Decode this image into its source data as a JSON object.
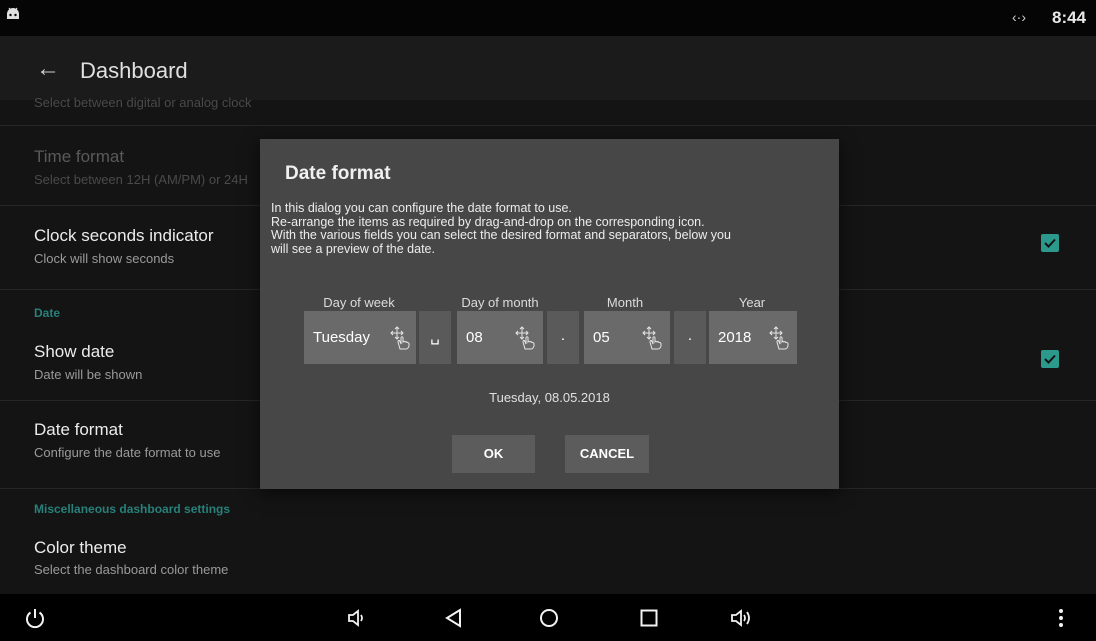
{
  "status_bar": {
    "time": "8:44",
    "signal_icon": "data-transfer-icon"
  },
  "action_bar": {
    "title": "Dashboard",
    "back_icon": "arrow-left-icon"
  },
  "preferences": {
    "partial_top_summary": "Select between digital or analog clock",
    "time_format": {
      "title": "Time format",
      "summary": "Select between 12H (AM/PM) or 24H"
    },
    "clock_seconds": {
      "title": "Clock seconds indicator",
      "summary": "Clock will show seconds",
      "checked": true
    },
    "date_category": "Date",
    "show_date": {
      "title": "Show date",
      "summary": "Date will be shown",
      "checked": true
    },
    "date_format": {
      "title": "Date format",
      "summary": "Configure the date format to use"
    },
    "misc_category": "Miscellaneous dashboard settings",
    "color_theme": {
      "title": "Color theme",
      "summary": "Select the dashboard color theme"
    }
  },
  "dialog": {
    "title": "Date format",
    "message_lines": [
      "In this dialog you can configure the date format to use.",
      "Re-arrange the items as required by drag-and-drop on the corresponding icon.",
      "With the various fields you can select the desired format and separators, below you",
      "will see a preview of the date."
    ],
    "fields": [
      {
        "label": "Day of week",
        "value": "Tuesday"
      },
      {
        "label": "Day of month",
        "value": "08"
      },
      {
        "label": "Month",
        "value": "05"
      },
      {
        "label": "Year",
        "value": "2018"
      }
    ],
    "separators": [
      "␣",
      ".",
      "."
    ],
    "preview": "Tuesday, 08.05.2018",
    "ok_label": "OK",
    "cancel_label": "CANCEL"
  },
  "nav_bar": {
    "icons": [
      "power-icon",
      "volume-down-icon",
      "back-triangle-icon",
      "home-circle-icon",
      "recents-square-icon",
      "volume-up-icon",
      "more-vert-icon"
    ]
  },
  "colors": {
    "accent": "#2b9a8c",
    "category": "#27807a",
    "dialog_bg": "#474747",
    "field_bg": "#6a6a6a"
  }
}
